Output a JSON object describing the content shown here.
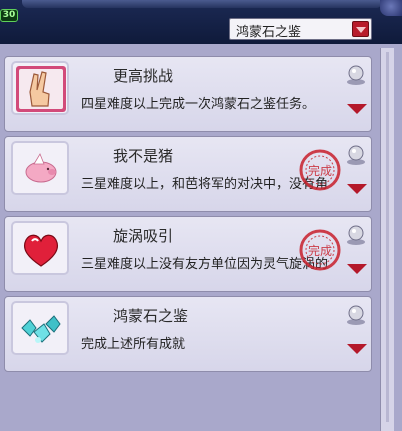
{
  "header": {
    "level_badge": "30",
    "dropdown": {
      "selected": "鸿蒙石之鉴"
    }
  },
  "achievements": [
    {
      "title": "更高挑战",
      "description": "四星难度以上完成一次鸿蒙石之鉴任务。",
      "icon": "peace-hand-icon",
      "completed": false
    },
    {
      "title": "我不是猪",
      "description": "三星难度以上，和芭将军的对决中，没有角",
      "icon": "flying-pig-icon",
      "completed": true,
      "stamp_text": "完成"
    },
    {
      "title": "旋涡吸引",
      "description": "三星难度以上没有友方单位因为灵气旋涡的",
      "icon": "heart-icon",
      "completed": true,
      "stamp_text": "完成"
    },
    {
      "title": "鸿蒙石之鉴",
      "description": "完成上述所有成就",
      "icon": "crystal-cluster-icon",
      "completed": false
    }
  ],
  "colors": {
    "accent_red": "#b4182a",
    "panel": "#a9a8cb",
    "card": "#e2e1f0"
  }
}
